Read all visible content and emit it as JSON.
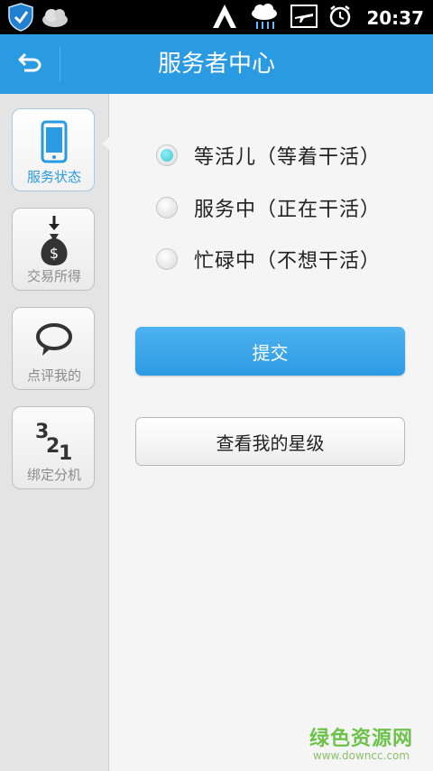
{
  "status_bar": {
    "time": "20:37",
    "icons": [
      "shield-icon",
      "cloud-icon",
      "app-a-icon",
      "weather-rain-icon",
      "airplane-mode-icon",
      "alarm-clock-icon"
    ]
  },
  "header": {
    "title": "服务者中心",
    "back_icon": "back-arrow-icon"
  },
  "sidebar": {
    "items": [
      {
        "label": "服务状态",
        "icon": "phone-icon",
        "active": true
      },
      {
        "label": "交易所得",
        "icon": "money-bag-icon",
        "active": false
      },
      {
        "label": "点评我的",
        "icon": "speech-bubble-icon",
        "active": false
      },
      {
        "label": "绑定分机",
        "icon": "numbers-321-icon",
        "active": false
      }
    ]
  },
  "main": {
    "status_options": [
      {
        "label": "等活儿（等着干活）",
        "checked": true
      },
      {
        "label": "服务中（正在干活）",
        "checked": false
      },
      {
        "label": "忙碌中（不想干活）",
        "checked": false
      }
    ],
    "submit_label": "提交",
    "view_star_label": "查看我的星级"
  },
  "watermark": {
    "cn": "绿色资源网",
    "en": "www.downcc.com"
  },
  "colors": {
    "accent": "#2a9ae3",
    "radio_checked": "#3bc7d3",
    "watermark": "#6dc24a"
  }
}
